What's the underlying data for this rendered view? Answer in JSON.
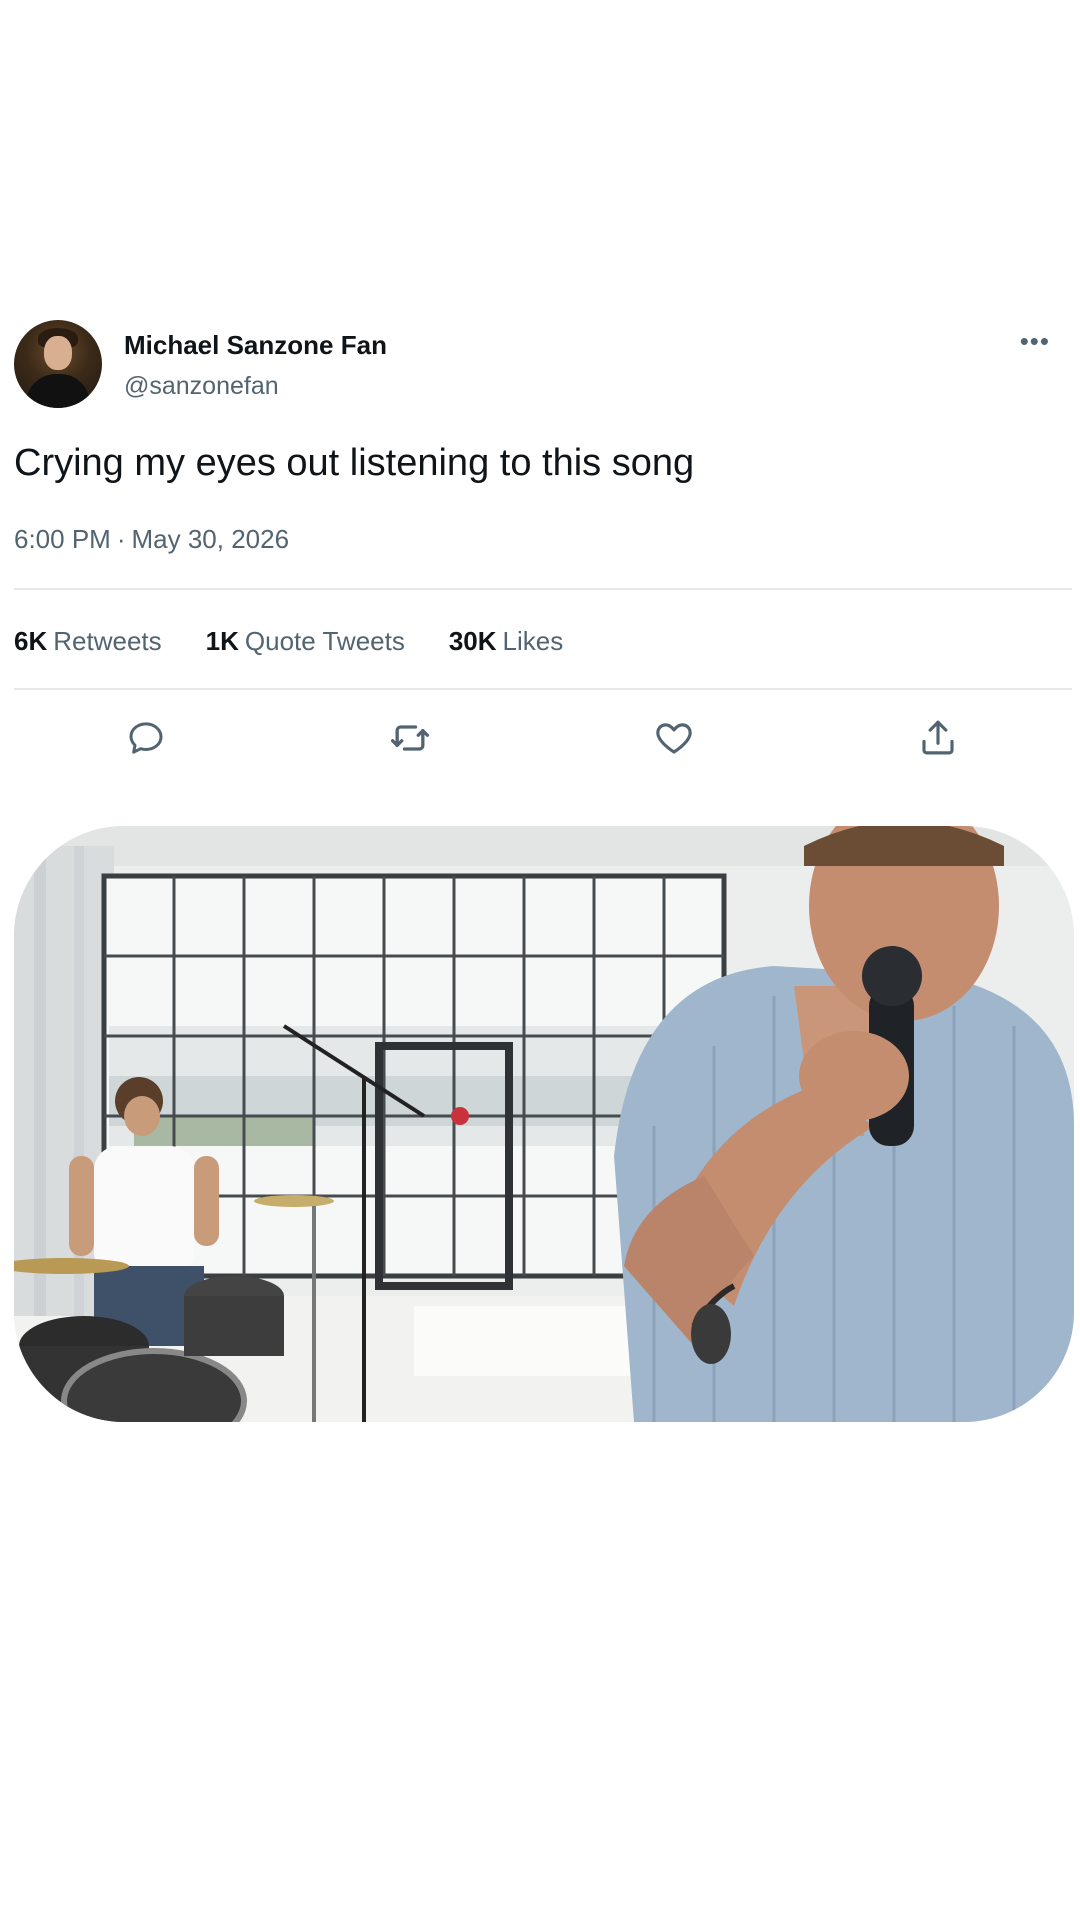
{
  "tweet": {
    "display_name": "Michael Sanzone Fan",
    "handle": "@sanzonefan",
    "more_label": "•••",
    "text": "Crying my eyes out listening to this song",
    "time": "6:00 PM",
    "separator": "·",
    "date": "May 30, 2026"
  },
  "stats": {
    "retweets_count": "6K",
    "retweets_label": "Retweets",
    "quotes_count": "1K",
    "quotes_label": "Quote Tweets",
    "likes_count": "30K",
    "likes_label": "Likes"
  },
  "actions": [
    {
      "icon": "reply-icon"
    },
    {
      "icon": "retweet-icon"
    },
    {
      "icon": "like-icon"
    },
    {
      "icon": "share-icon"
    }
  ],
  "media": {
    "description_icon": "video-thumbnail"
  },
  "colors": {
    "text_primary": "#0f1419",
    "text_secondary": "#536471",
    "divider": "#e6e9eb"
  }
}
